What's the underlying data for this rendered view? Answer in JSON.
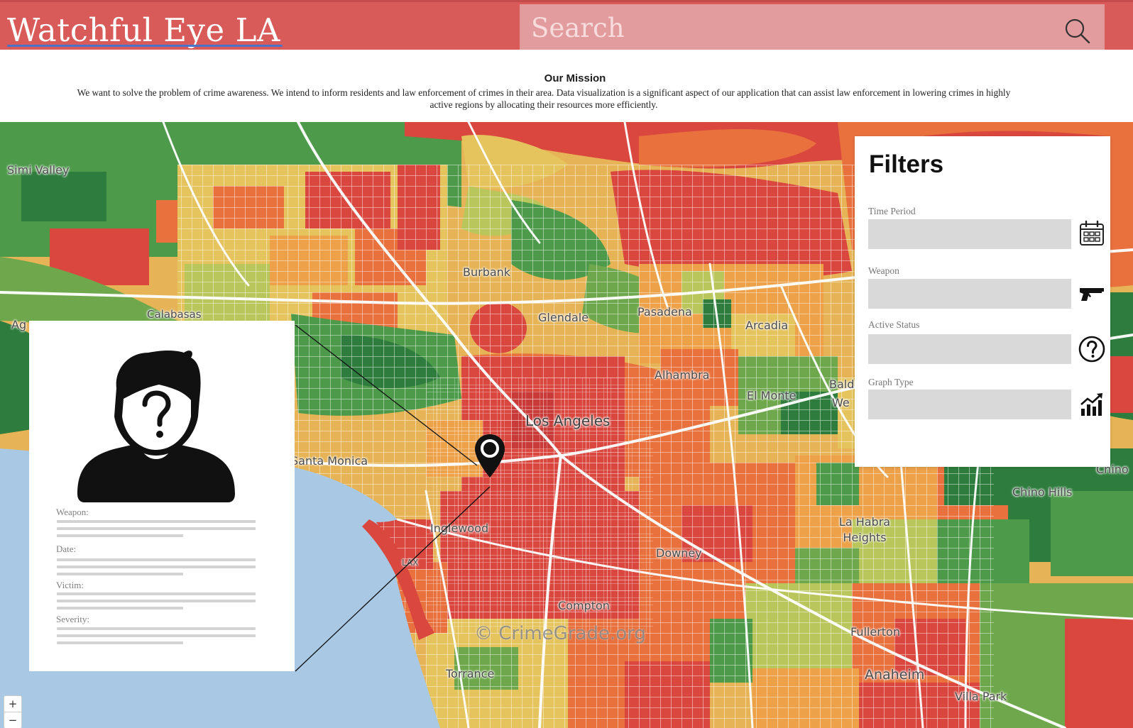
{
  "header": {
    "brand": "Watchful Eye LA",
    "search_placeholder": "Search"
  },
  "mission": {
    "title": "Our Mission",
    "text": "We want to solve the problem of crime awareness. We intend to inform residents and law enforcement of crimes in their area. Data visualization is a significant aspect of our application that can assist law enforcement in lowering crimes in highly active regions by allocating their resources more efficiently."
  },
  "map": {
    "watermark": "© CrimeGrade.org",
    "places": {
      "simi_valley": "Simi Valley",
      "burbank": "Burbank",
      "glendale": "Glendale",
      "pasadena": "Pasadena",
      "arcadia": "Arcadia",
      "alhambra": "Alhambra",
      "el_monte": "El Monte",
      "baldwin": "Baldwi",
      "we": "We",
      "los_angeles": "Los Angeles",
      "santa_monica": "Santa Monica",
      "inglewood": "Inglewood",
      "lax": "LAX",
      "downey": "Downey",
      "compton": "Compton",
      "fullerton": "Fullerton",
      "la_habra_heights": "La Habra Heights",
      "chino_hills": "Chino Hills",
      "chino": "Chino",
      "anaheim": "Anaheim",
      "villa_park": "Villa Park",
      "torrance": "Torrance",
      "calabasas": "Calabasas",
      "ag": "Ag"
    },
    "zoom": {
      "in": "+",
      "out": "−"
    },
    "colors": {
      "high": "#d9473f",
      "elevated": "#e8713e",
      "moderate": "#eda24a",
      "low_moderate": "#e5c35d",
      "low": "#b9c65b",
      "very_low": "#6fa84c",
      "lowest": "#2f7d3e",
      "water": "#a9c8e4"
    }
  },
  "filters": {
    "title": "Filters",
    "time_period_label": "Time Period",
    "weapon_label": "Weapon",
    "active_status_label": "Active Status",
    "graph_type_label": "Graph Type",
    "icons": [
      "calendar-icon",
      "gun-icon",
      "question-circle-icon",
      "bar-chart-icon"
    ]
  },
  "detail": {
    "weapon_label": "Weapon:",
    "date_label": "Date:",
    "victim_label": "Victim:",
    "severity_label": "Severity:",
    "icon": "unknown-person-icon"
  }
}
